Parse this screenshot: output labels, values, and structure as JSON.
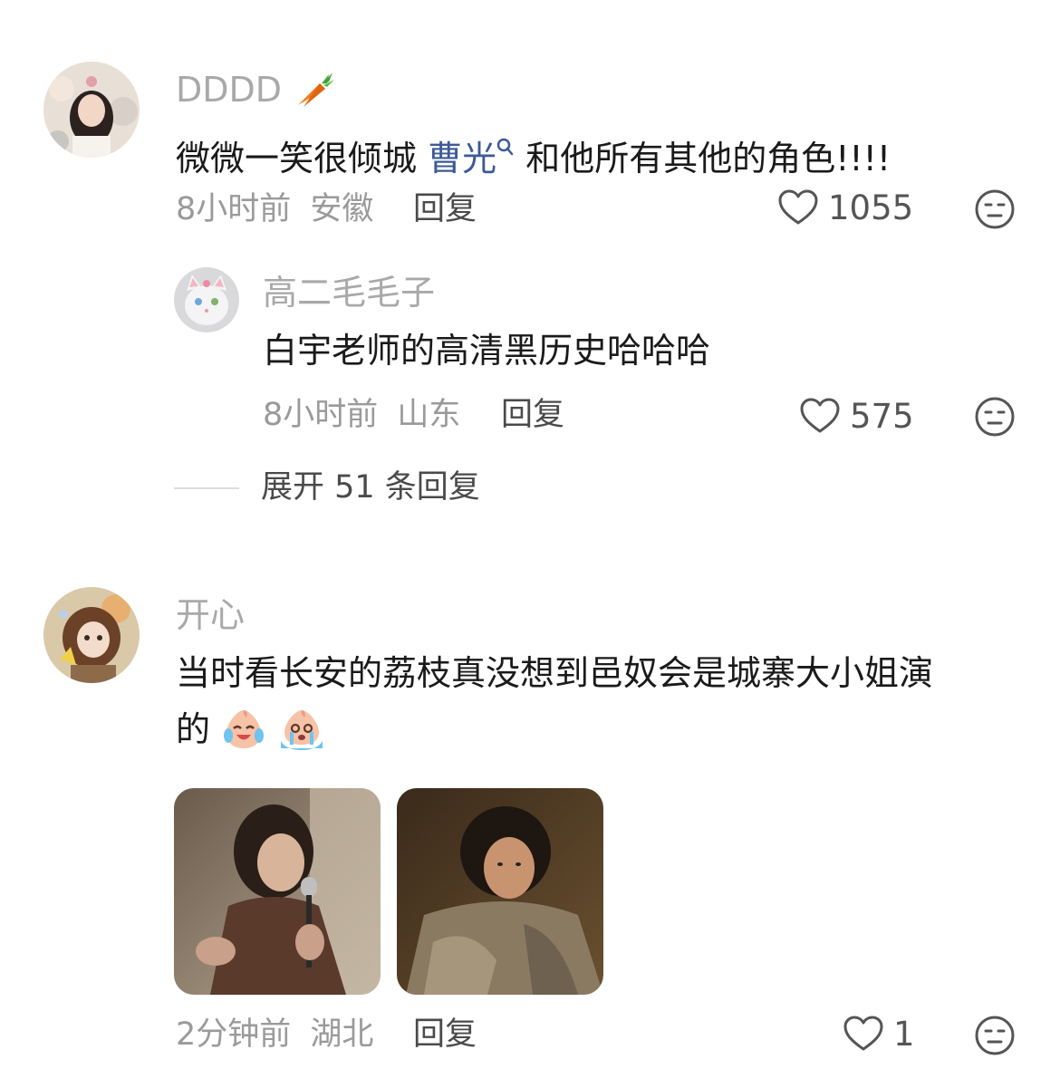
{
  "comments": [
    {
      "username": "DDDD",
      "username_icon": "carrot-icon",
      "text_before": "微微一笑很倾城 ",
      "mention": "曹光",
      "text_after": " 和他所有其他的角色!!!!",
      "time": "8小时前",
      "location": "安徽",
      "reply_label": "回复",
      "likes": "1055",
      "replies": [
        {
          "username": "高二毛毛子",
          "text": "白宇老师的高清黑历史哈哈哈",
          "time": "8小时前",
          "location": "山东",
          "reply_label": "回复",
          "likes": "575"
        }
      ],
      "expand_label": "展开 51 条回复"
    },
    {
      "username": "开心",
      "text_line1": "当时看长安的荔枝真没想到邑奴会是城寨大小姐演",
      "text_line2": "的",
      "emojis": [
        "laugh-cry-emoji",
        "crying-emoji"
      ],
      "time": "2分钟前",
      "location": "湖北",
      "reply_label": "回复",
      "likes": "1"
    }
  ],
  "colors": {
    "mention": "#3d5a96",
    "username": "#a9a9a9",
    "meta": "#9a9a9a",
    "text": "#1a1a1a"
  }
}
